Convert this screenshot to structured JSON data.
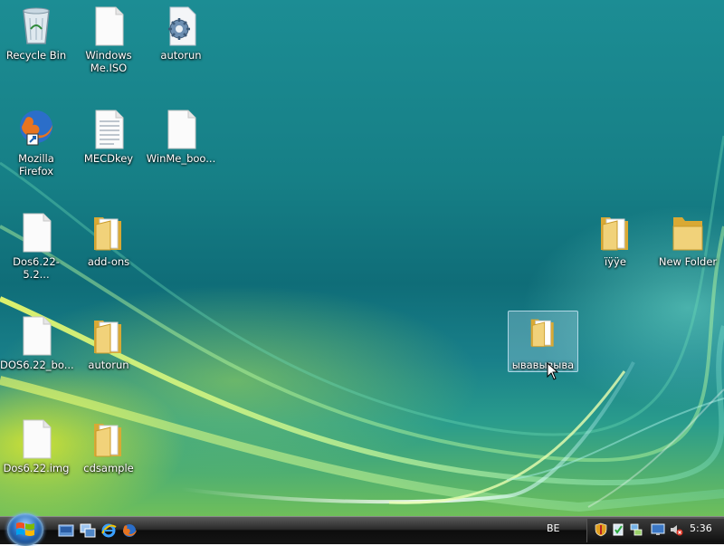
{
  "desktop_icons": [
    {
      "label": "Recycle Bin",
      "type": "recycle-bin"
    },
    {
      "label": "Windows\nMe.ISO",
      "type": "file"
    },
    {
      "label": "autorun",
      "type": "setup-file"
    },
    {
      "label": "Mozilla Firefox",
      "type": "firefox-shortcut"
    },
    {
      "label": "MECDkey",
      "type": "text-file"
    },
    {
      "label": "WinMe_boo...",
      "type": "file"
    },
    {
      "label": "Dos6.22-5.2...",
      "type": "file"
    },
    {
      "label": "add-ons",
      "type": "folder"
    },
    {
      "label": "DOS6.22_bo...",
      "type": "file"
    },
    {
      "label": "autorun",
      "type": "folder"
    },
    {
      "label": "Dos6.22.img",
      "type": "file"
    },
    {
      "label": "cdsample",
      "type": "folder"
    },
    {
      "label": "ïÿÿe",
      "type": "folder"
    },
    {
      "label": "New Folder",
      "type": "folder"
    },
    {
      "label": "ывавывыва",
      "type": "folder",
      "selected": true
    }
  ],
  "taskbar": {
    "start_icon": "windows-orb-icon",
    "quick_launch": [
      "show-desktop-icon",
      "switch-windows-icon",
      "internet-explorer-icon",
      "firefox-icon"
    ],
    "language": "BE",
    "tray_icons": [
      "security-shield-icon",
      "action-center-icon",
      "network-icon",
      "monitor-icon",
      "volume-muted-icon"
    ],
    "clock": "5:36"
  },
  "colors": {
    "desktop_teal": "#167f86",
    "taskbar_black": "#151515",
    "selection": "#bee1f5",
    "folder_yellow": "#e8c25a"
  }
}
